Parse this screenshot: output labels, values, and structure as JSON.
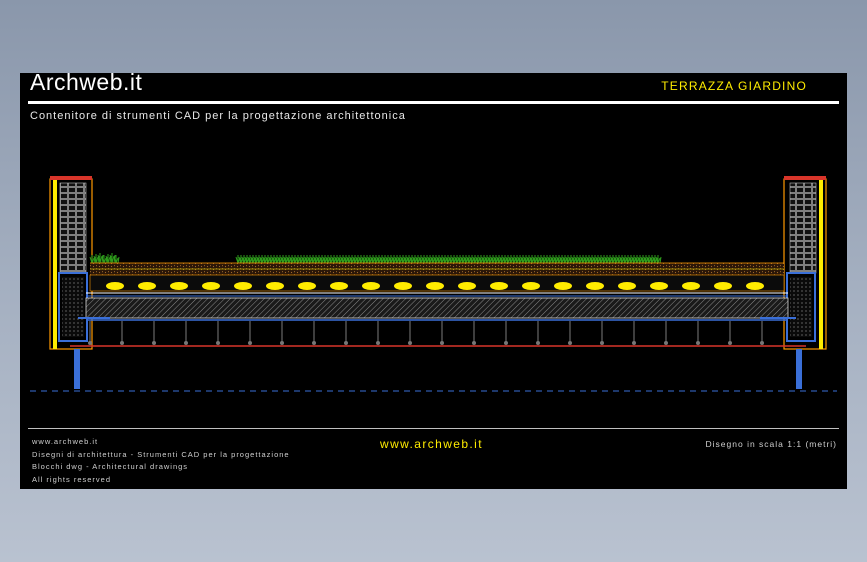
{
  "header": {
    "brand": "Archweb.it",
    "sheet_title": "TERRAZZA GIARDINO",
    "subtitle": "Contenitore di strumenti CAD per la progettazione architettonica"
  },
  "footer": {
    "lines": [
      "www.archweb.it",
      "Disegni di architettura - Strumenti CAD per la progettazione",
      "Blocchi dwg - Architectural drawings",
      "All rights reserved"
    ],
    "center_url": "www.archweb.it",
    "scale_note": "Disegno in scala 1:1 (metri)"
  },
  "colors": {
    "sheet_background": "#000000",
    "accent_yellow": "#ffec00",
    "wall_orange": "#ff9a00",
    "vegetation_green": "#2f9e1d",
    "slab_blue": "#3a6fd8",
    "membrane_red": "#d9352a"
  }
}
